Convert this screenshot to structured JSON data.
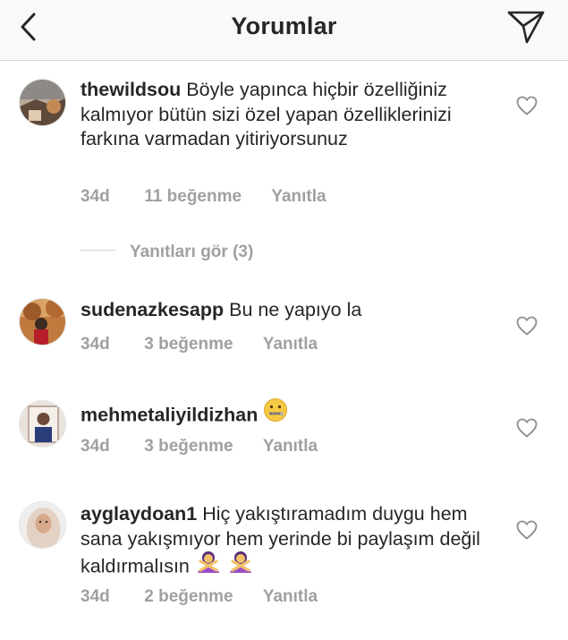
{
  "header": {
    "title": "Yorumlar",
    "back_icon": "chevron-left-icon",
    "send_icon": "paper-plane-icon"
  },
  "colors": {
    "text": "#262626",
    "meta_text": "#a0a0a0",
    "header_bg": "#f9f9f9",
    "divider": "#d8d8d8"
  },
  "comments": [
    {
      "username": "thewildsou",
      "text": "Böyle yapınca hiçbir özelliğiniz kalmıyor bütün sizi özel yapan özelliklerinizi farkına varmadan yitiriyorsunuz",
      "age": "34d",
      "likes": "11 beğenme",
      "reply": "Yanıtla",
      "emojis": []
    },
    {
      "username": "sudenazkesapp",
      "text": "Bu ne yapıyo la",
      "age": "34d",
      "likes": "3 beğenme",
      "reply": "Yanıtla",
      "emojis": []
    },
    {
      "username": "mehmetaliyildizhan",
      "text": "",
      "age": "34d",
      "likes": "3 beğenme",
      "reply": "Yanıtla",
      "emojis": [
        "zipper-mouth-face-emoji"
      ]
    },
    {
      "username": "ayglaydoan1",
      "text": "Hiç yakıştıramadım duygu hem sana yakışmıyor hem yerinde bi paylaşım değil kaldırmalısın",
      "age": "34d",
      "likes": "2 beğenme",
      "reply": "Yanıtla",
      "emojis": [
        "person-gesturing-no-emoji",
        "person-gesturing-no-emoji"
      ]
    }
  ],
  "view_replies": {
    "label": "Yanıtları gör (3)"
  }
}
